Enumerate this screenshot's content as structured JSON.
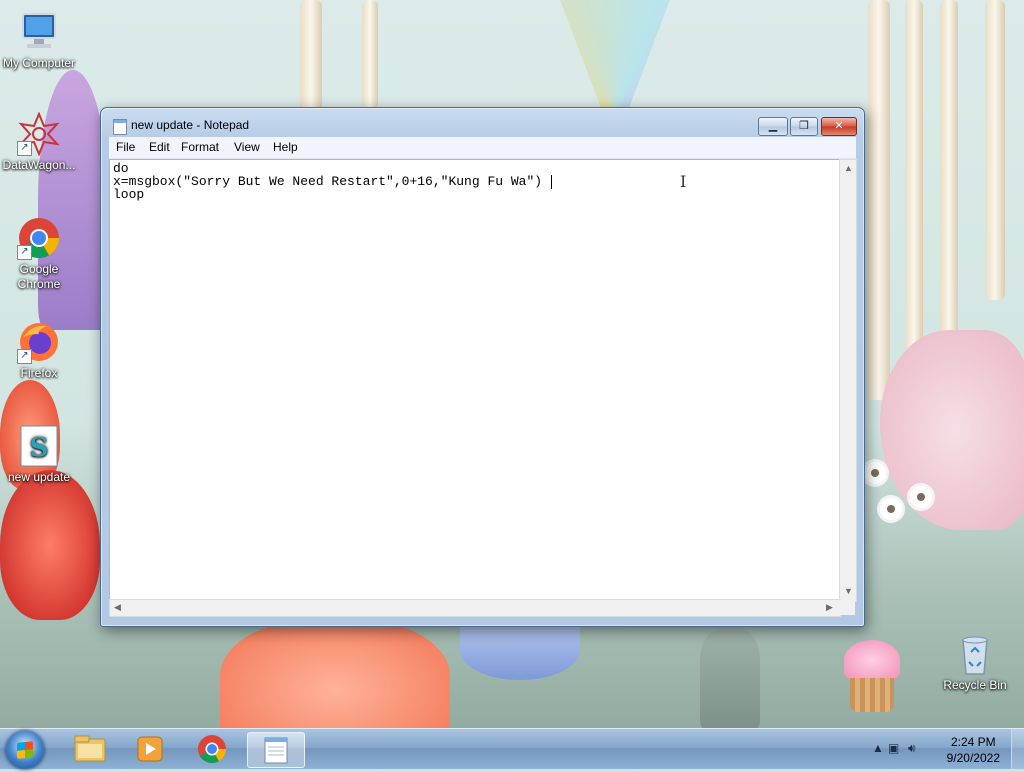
{
  "desktop": {
    "icons": [
      {
        "label": "My Computer",
        "icon": "computer-icon"
      },
      {
        "label": "DataWagon...",
        "icon": "datawagon-icon"
      },
      {
        "label": "Google Chrome",
        "icon": "chrome-icon"
      },
      {
        "label": "Firefox",
        "icon": "firefox-icon"
      },
      {
        "label": "new update",
        "icon": "script-file-icon"
      },
      {
        "label": "Recycle Bin",
        "icon": "recycle-bin-icon"
      }
    ]
  },
  "notepad": {
    "title": "new update - Notepad",
    "menu": [
      "File",
      "Edit",
      "Format",
      "View",
      "Help"
    ],
    "lines": [
      "do",
      "x=msgbox(\"Sorry But We Need Restart\",0+16,\"Kung Fu Wa\")",
      "loop"
    ],
    "accent_close": "#c7412a"
  },
  "taskbar": {
    "pinned": [
      "explorer-icon",
      "media-player-icon",
      "chrome-icon",
      "notepad-icon"
    ],
    "active": "notepad-icon",
    "clock_time": "2:24 PM",
    "clock_date": "9/20/2022"
  }
}
